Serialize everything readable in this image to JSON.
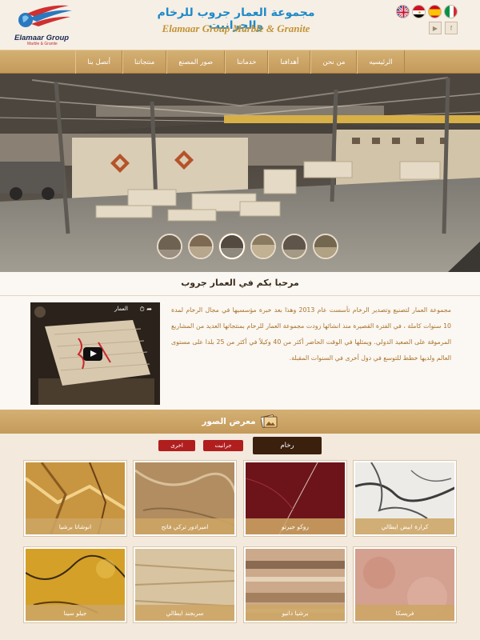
{
  "header": {
    "logo_text": "Elamaar Group",
    "logo_sub": "Marble & Granite",
    "brand_ar": "مجموعة العمار جروب للرخام والجرانيت",
    "brand_en": "Elamaar Group Marble & Granite",
    "flags": [
      "uk-flag",
      "egypt-flag",
      "spain-flag",
      "italy-flag"
    ],
    "social": [
      "youtube-icon",
      "facebook-icon"
    ]
  },
  "nav": {
    "items": [
      "الرئيسيه",
      "من نحن",
      "أهدافنا",
      "خدماتنا",
      "صور المصنع",
      "منتجاتنا",
      "أتصل بنا"
    ]
  },
  "welcome": {
    "title": "مرحبا بكم في العمار جروب",
    "video_title": "العمار",
    "about": "مجموعة العمار لتصنيع وتصدير الرخام تأسست عام 2013 وهذا بعد خبرة مؤسسيها في مجال الرخام لمدة 10 سنوات كاملة ، في الفترة القصيرة منذ انشائها زودت مجموعة العمار للرخام بمنتجاتها العديد من المشاريع المرموقة على الصعيد الدولي. ويمثلها في الوقت الحاضر أكثر من 40 وكيلاً في أكثر من 25 بلدا على مستوى العالم ولديها خطط للتوسع في دول أخرى في السنوات المقبلة."
  },
  "gallery": {
    "title": "معرض الصور",
    "tabs": [
      "رخام",
      "جرانيت",
      "اخرى"
    ],
    "row1": [
      "كرارة ابيض ايطالي",
      "روكو جيرتو",
      "امبرادور تركي فاتح",
      "انوشاتا برشيا"
    ],
    "row2": [
      "فريسكا",
      "برشيا دانيو",
      "سربجند ايطالي",
      "جيلو سينا"
    ]
  },
  "colors": {
    "accent": "#c49a5a",
    "text_gold": "#a8742e",
    "brand_blue": "#1f8ac8",
    "tab_dark": "#3b200e",
    "tab_red": "#b01e1e"
  }
}
